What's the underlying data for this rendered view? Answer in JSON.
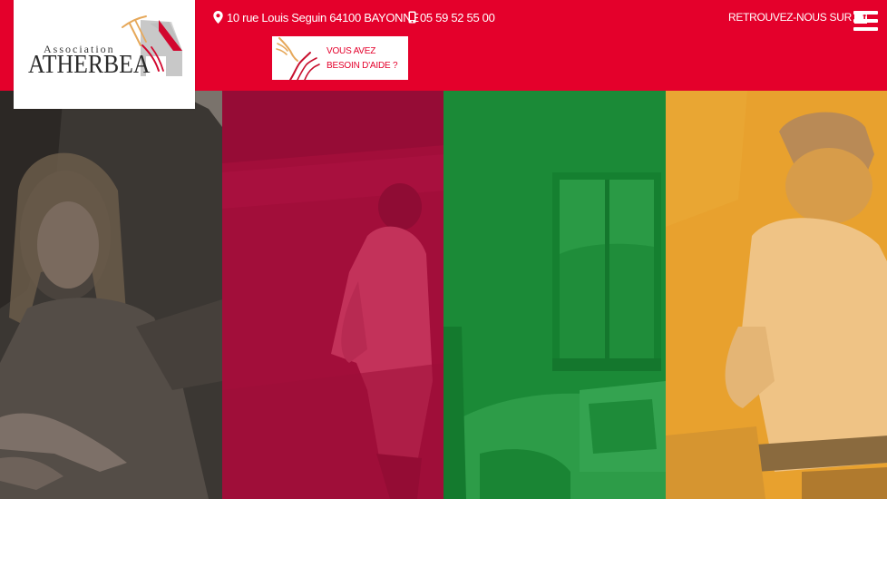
{
  "header": {
    "logo": {
      "small": "Association",
      "big": "ATHERBEA"
    },
    "address": "10 rue Louis Seguin 64100 BAYONNE",
    "phone": "05 59 52 55 00",
    "social_label": "RETROUVEZ-NOUS SUR",
    "social_icon": "facebook-icon",
    "help_button": {
      "line1": "VOUS AVEZ",
      "line2": "BESOIN D'AIDE ?"
    },
    "menu_icon": "hamburger-menu-icon"
  },
  "colors": {
    "header": "#e4002b",
    "panel_dark": "#3b3733",
    "panel_crimson": "#a20e3a",
    "panel_green": "#1b8a37",
    "panel_orange": "#e8a12e"
  }
}
